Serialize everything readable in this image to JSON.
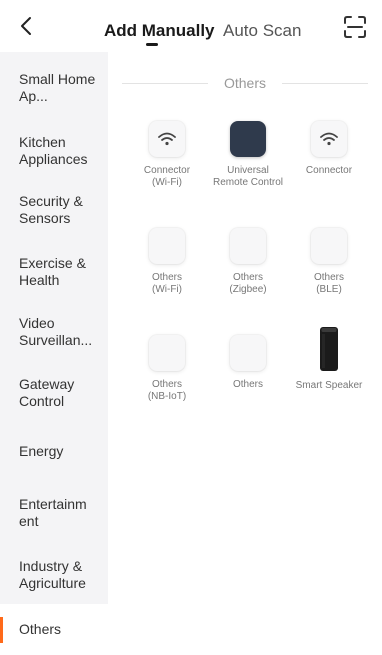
{
  "header": {
    "tabs": [
      {
        "label": "Add Manually",
        "active": true
      },
      {
        "label": "Auto Scan",
        "active": false
      }
    ]
  },
  "sidebar": {
    "items": [
      {
        "label": "Small Home Ap..."
      },
      {
        "label": "Kitchen Appliances"
      },
      {
        "label": "Security & Sensors"
      },
      {
        "label": "Exercise & Health"
      },
      {
        "label": "Video Surveillan..."
      },
      {
        "label": "Gateway Control"
      },
      {
        "label": "Energy"
      },
      {
        "label": "Entertainm ent"
      },
      {
        "label": "Industry & Agriculture"
      },
      {
        "label": "Others",
        "active": true
      }
    ]
  },
  "main": {
    "section_title": "Others",
    "devices": [
      {
        "name": "Connector",
        "sub": "(Wi-Fi)",
        "icon": "wifi-icon"
      },
      {
        "name": "Universal",
        "sub": "Remote Control",
        "icon": "remote-control-icon"
      },
      {
        "name": "Connector",
        "sub": "",
        "icon": "wifi-icon"
      },
      {
        "name": "Others",
        "sub": "(Wi-Fi)",
        "icon": "blank-device-icon"
      },
      {
        "name": "Others",
        "sub": "(Zigbee)",
        "icon": "blank-device-icon"
      },
      {
        "name": "Others",
        "sub": "(BLE)",
        "icon": "blank-device-icon"
      },
      {
        "name": "Others",
        "sub": "(NB-IoT)",
        "icon": "blank-device-icon"
      },
      {
        "name": "Others",
        "sub": "",
        "icon": "blank-device-icon"
      },
      {
        "name": "Smart Speaker",
        "sub": "",
        "icon": "smart-speaker-icon"
      }
    ]
  },
  "colors": {
    "accent": "#ff6a1a",
    "sidebar_bg": "#f4f4f6",
    "remote_tile": "#2f3a4c"
  }
}
